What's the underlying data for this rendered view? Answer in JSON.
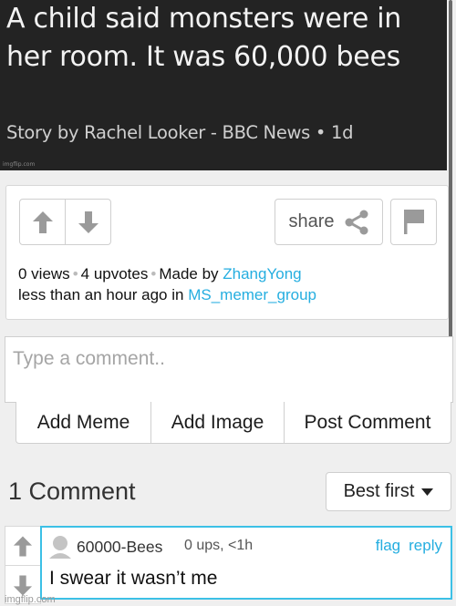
{
  "article": {
    "title": "A child said monsters were in her room. It was 60,000 bees",
    "byline": "Story by Rachel Looker - BBC News • 1d",
    "watermark": "imgflip.com"
  },
  "post": {
    "upvote_icon": "arrow-up",
    "downvote_icon": "arrow-down",
    "share_label": "share",
    "share_icon": "share-nodes",
    "flag_icon": "flag",
    "views": "0 views",
    "upvotes": "4 upvotes",
    "made_by_prefix": "Made by",
    "author": "ZhangYong",
    "time_prefix": "less than an hour ago in",
    "stream": "MS_memer_group",
    "separator": "•"
  },
  "composer": {
    "placeholder": "Type a comment..",
    "buttons": [
      "Add Meme",
      "Add Image",
      "Post Comment"
    ]
  },
  "comments_section": {
    "count_label": "1 Comment",
    "sort_label": "Best first",
    "comments": [
      {
        "user": "60000-Bees",
        "info": "0 ups, <1h",
        "flag_label": "flag",
        "reply_label": "reply",
        "text": "I swear it wasn’t me"
      }
    ]
  },
  "watermark_bottom": "imgflip.com",
  "colors": {
    "link": "#25aee0",
    "comment_border": "#3cc0e6",
    "header_bg": "#232323"
  }
}
